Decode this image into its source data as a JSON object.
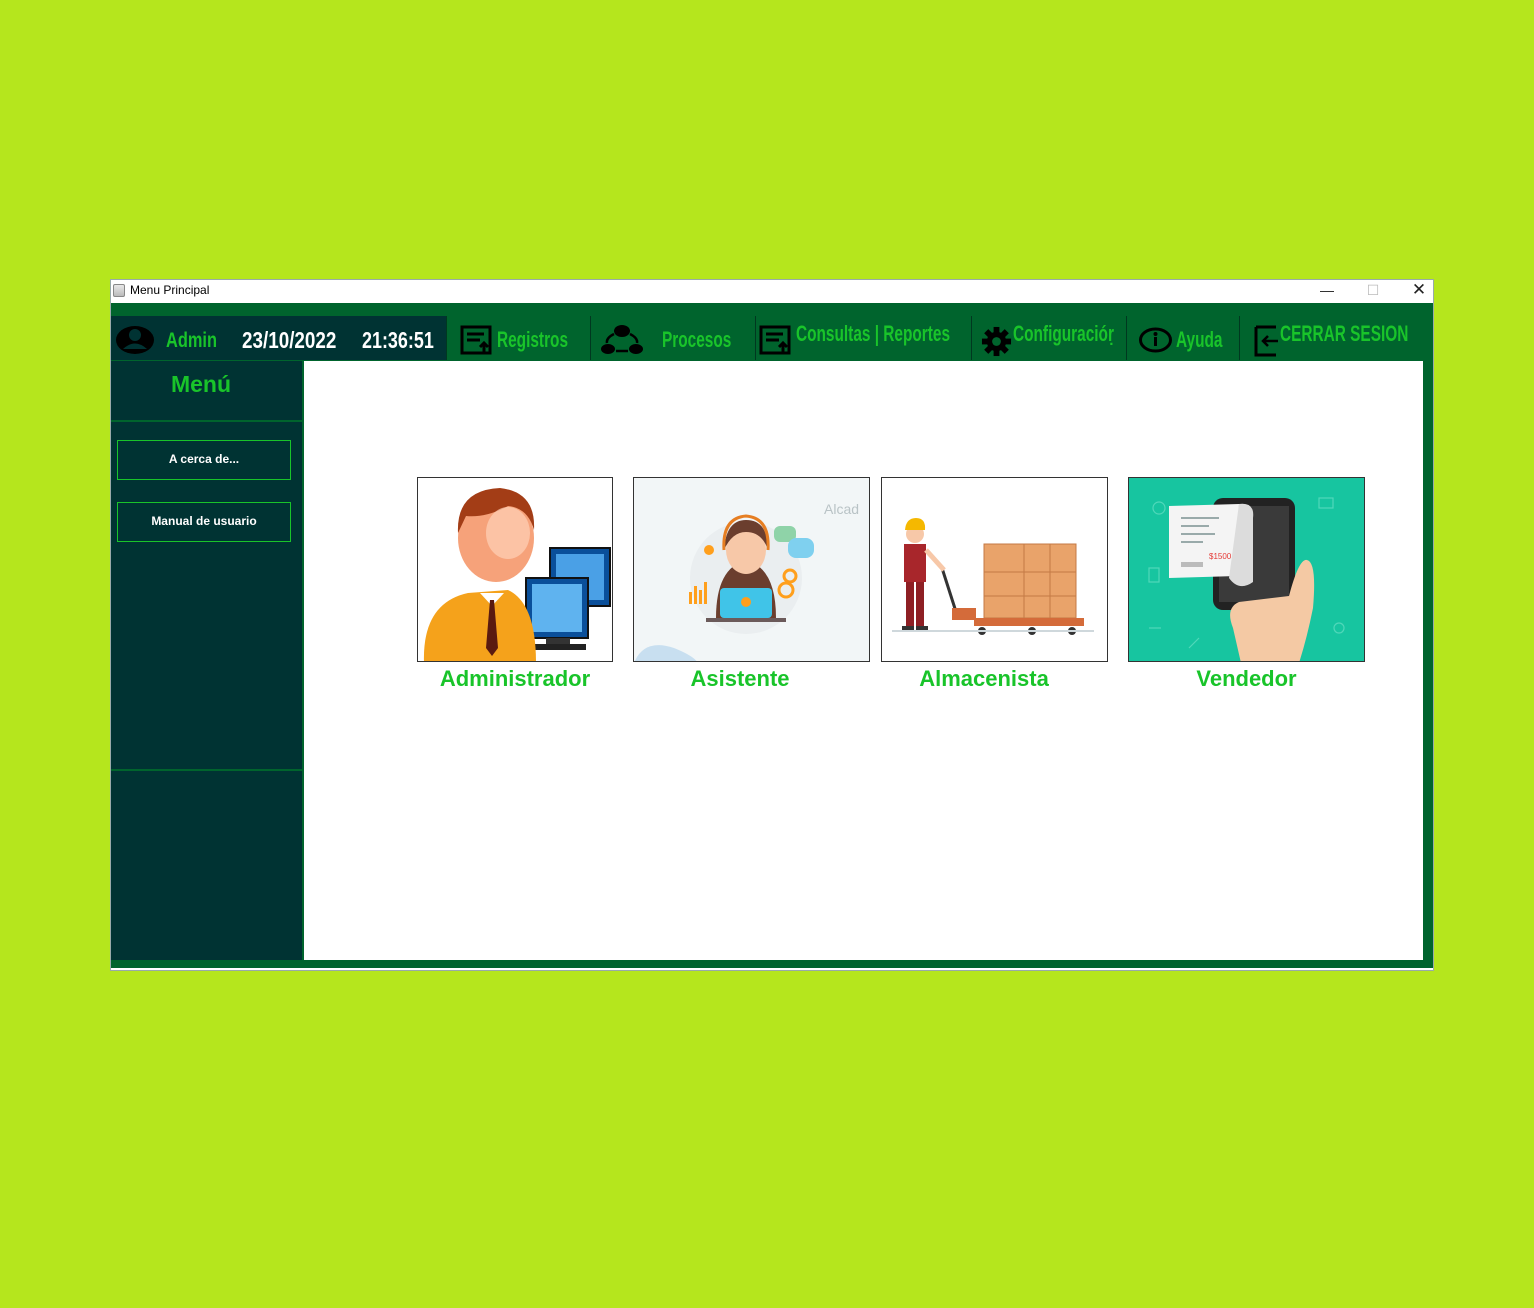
{
  "window": {
    "title": "Menu Principal"
  },
  "titlebar_buttons": {
    "minimize": "—",
    "maximize": "☐",
    "close": "✕"
  },
  "toolbar": {
    "user": "Admin",
    "date": "23/10/2022",
    "time": "21:36:51",
    "buttons": [
      {
        "label": "Registros",
        "icon": "registry-icon"
      },
      {
        "label": "Procesos",
        "icon": "process-icon"
      },
      {
        "label": "Consultas | Reportes",
        "icon": "report-icon"
      },
      {
        "label": "Configuracióṛ",
        "icon": "gear-icon"
      },
      {
        "label": "Ayuda",
        "icon": "info-icon"
      },
      {
        "label": "CERRAR SESION",
        "icon": "logout-icon"
      }
    ]
  },
  "sidebar": {
    "title": "Menú",
    "items": [
      {
        "label": "A cerca de..."
      },
      {
        "label": "Manual de usuario"
      }
    ]
  },
  "roles": [
    {
      "label": "Administrador",
      "image": "administrator-illustration"
    },
    {
      "label": "Asistente",
      "image": "assistant-illustration",
      "watermark": "Alcad"
    },
    {
      "label": "Almacenista",
      "image": "warehouse-worker-illustration"
    },
    {
      "label": "Vendedor",
      "image": "seller-phone-illustration",
      "receipt_amount": "$1500"
    }
  ],
  "colors": {
    "background": "#b5e61d",
    "toolbar": "#00642d",
    "sidebar": "#003333",
    "accent": "#19c42a"
  }
}
